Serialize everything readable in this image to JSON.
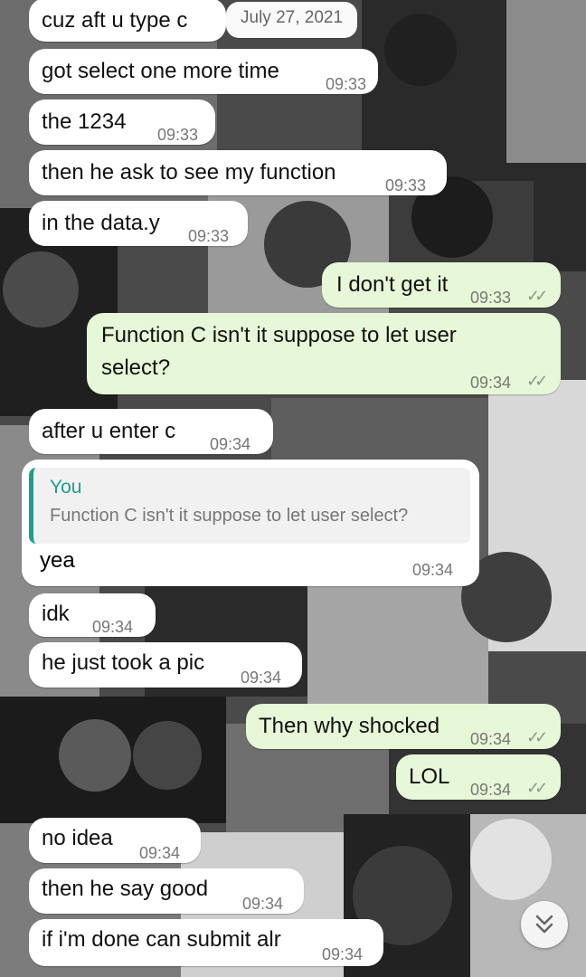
{
  "chat": {
    "date_label": "July 27, 2021",
    "messages": [
      {
        "text": "cuz aft u type c",
        "time": ""
      },
      {
        "text": "got select one more time",
        "time": "09:33"
      },
      {
        "text": "the 1234",
        "time": "09:33"
      },
      {
        "text": "then he ask to see my function",
        "time": "09:33"
      },
      {
        "text": "in the data.y",
        "time": "09:33"
      },
      {
        "text": "I don't get it",
        "time": "09:33"
      },
      {
        "text_line1": "Function C isn't it suppose to let user",
        "text_line2": "select?",
        "time": "09:34"
      },
      {
        "text": "after u enter c",
        "time": "09:34"
      },
      {
        "quote_author": "You",
        "quote_text": "Function C isn't it suppose to let user select?",
        "text": "yea",
        "time": "09:34"
      },
      {
        "text": "idk",
        "time": "09:34"
      },
      {
        "text": "he just took a pic",
        "time": "09:34"
      },
      {
        "text": "Then why shocked",
        "time": "09:34"
      },
      {
        "text": "LOL",
        "time": "09:34"
      },
      {
        "text": "no idea",
        "time": "09:34"
      },
      {
        "text": "then he say good",
        "time": "09:34"
      },
      {
        "text": "if i'm done can submit alr",
        "time": "09:34"
      }
    ],
    "read_ticks": "✓✓",
    "scroll_down_icon": "chevron-double-down-icon",
    "colors": {
      "incoming_bubble": "#ffffff",
      "outgoing_bubble": "#e6f8d7",
      "quote_accent": "#1f9e8b",
      "timestamp": "#777777"
    }
  }
}
